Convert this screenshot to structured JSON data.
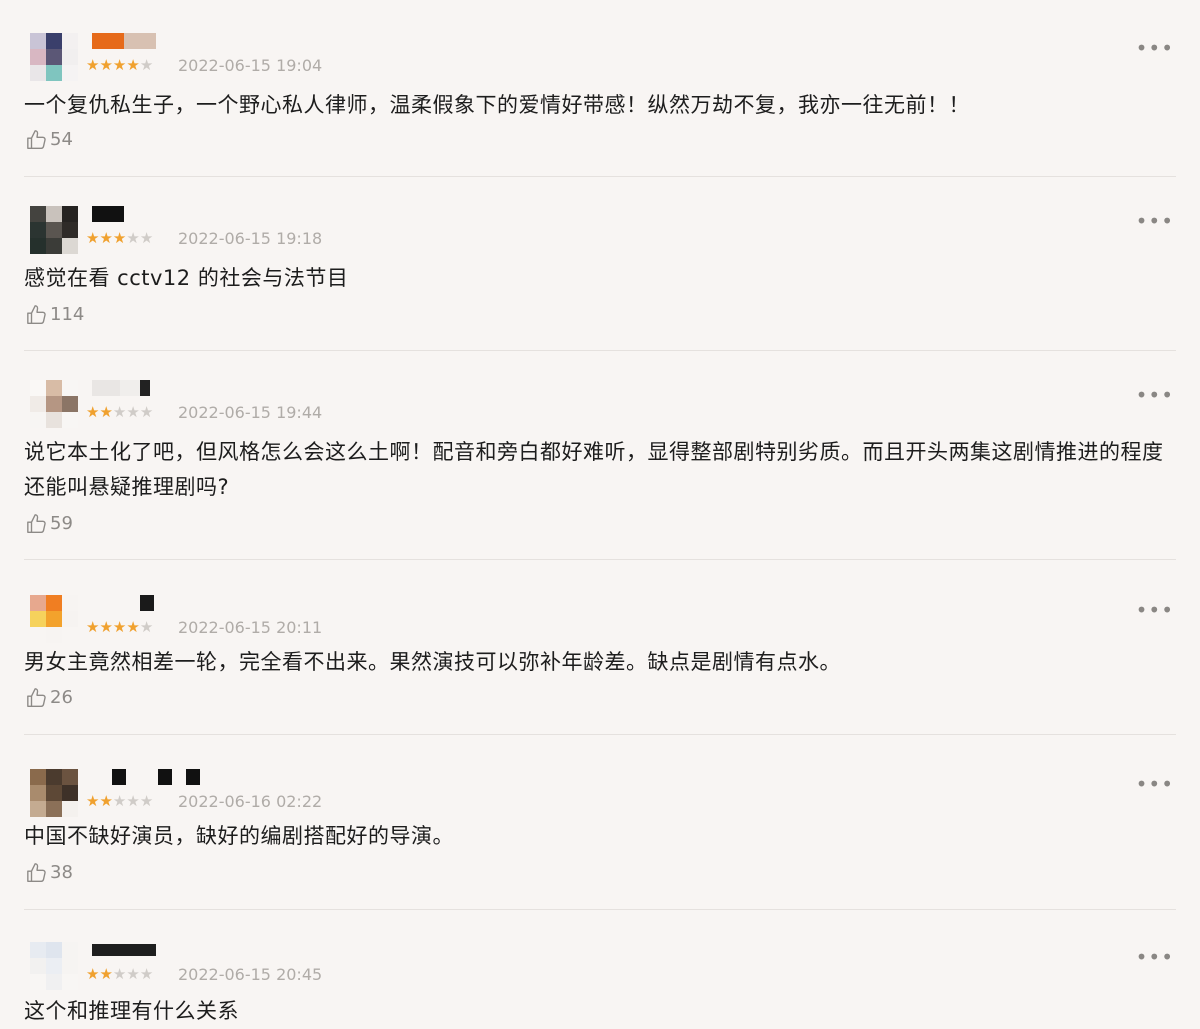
{
  "colors": {
    "background": "#f8f5f3",
    "star_active": "#f0a12f",
    "star_inactive": "#d0ccc8",
    "meta_text": "#b0aca8",
    "divider": "#e5e1de"
  },
  "icons": {
    "more": "more-dots-icon",
    "like": "thumbs-up-icon",
    "star": "star-icon"
  },
  "reviews": [
    {
      "rating": 4,
      "max_rating": 5,
      "date": "2022-06-15 19:04",
      "text": "一个复仇私生子，一个野心私人律师，温柔假象下的爱情好带感！纵然万劫不复，我亦一往无前！！",
      "likes": "54"
    },
    {
      "rating": 3,
      "max_rating": 5,
      "date": "2022-06-15 19:18",
      "text": "感觉在看 cctv12 的社会与法节目",
      "likes": "114"
    },
    {
      "rating": 2,
      "max_rating": 5,
      "date": "2022-06-15 19:44",
      "text": "说它本土化了吧，但风格怎么会这么土啊！配音和旁白都好难听，显得整部剧特别劣质。而且开头两集这剧情推进的程度还能叫悬疑推理剧吗?",
      "likes": "59"
    },
    {
      "rating": 4,
      "max_rating": 5,
      "date": "2022-06-15 20:11",
      "text": "男女主竟然相差一轮，完全看不出来。果然演技可以弥补年龄差。缺点是剧情有点水。",
      "likes": "26"
    },
    {
      "rating": 2,
      "max_rating": 5,
      "date": "2022-06-16 02:22",
      "text": "中国不缺好演员，缺好的编剧搭配好的导演。",
      "likes": "38"
    },
    {
      "rating": 2,
      "max_rating": 5,
      "date": "2022-06-15 20:45",
      "text": "这个和推理有什么关系",
      "likes": ""
    }
  ]
}
